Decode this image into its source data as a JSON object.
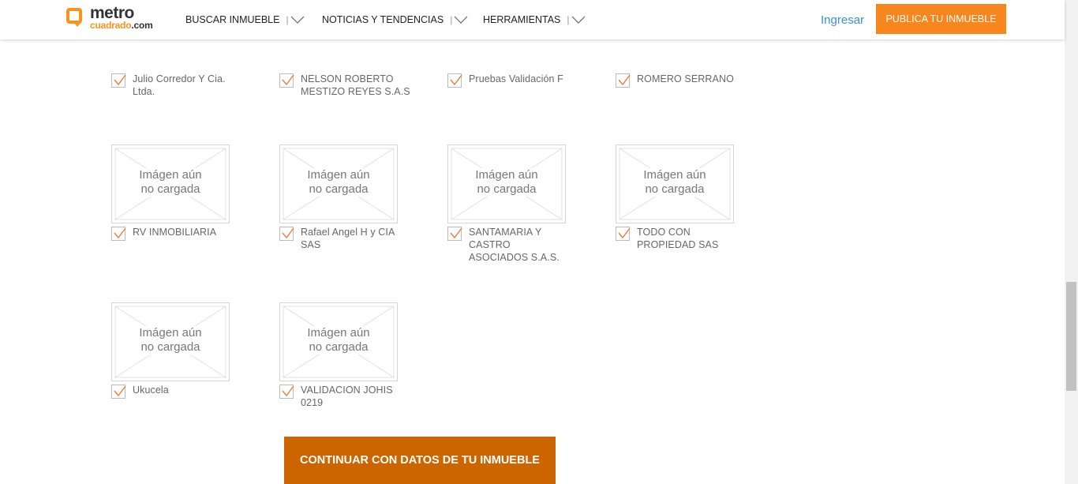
{
  "header": {
    "logo_top": "metro",
    "logo_bottom": "cuadrado",
    "logo_suffix": ".com",
    "nav": [
      {
        "label": "BUSCAR INMUEBLE"
      },
      {
        "label": "NOTICIAS Y TENDENCIAS"
      },
      {
        "label": "HERRAMIENTAS"
      }
    ],
    "login_label": "Ingresar",
    "publish_label": "PUBLICA TU INMUEBLE"
  },
  "placeholder": {
    "line1": "Imágen aún",
    "line2": "no cargada"
  },
  "top_row_logo_text": "cuadrado",
  "agencies": [
    {
      "name": "Julio Corredor Y Cia. Ltda.",
      "checked": true
    },
    {
      "name": "NELSON ROBERTO MESTIZO REYES S.A.S",
      "checked": true
    },
    {
      "name": "Pruebas Validación F",
      "checked": true
    },
    {
      "name": "ROMERO SERRANO",
      "checked": true
    },
    {
      "name": "RV INMOBILIARIA",
      "checked": true
    },
    {
      "name": "Rafael Angel H y CIA SAS",
      "checked": true
    },
    {
      "name": "SANTAMARIA Y CASTRO ASOCIADOS S.A.S.",
      "checked": true
    },
    {
      "name": "TODO CON PROPIEDAD SAS",
      "checked": true
    },
    {
      "name": "Ukucela",
      "checked": true
    },
    {
      "name": "VALIDACION JOHIS 0219",
      "checked": true
    }
  ],
  "continue_label": "CONTINUAR CON DATOS DE TU INMUEBLE",
  "colors": {
    "brand_orange": "#f7861d",
    "continue_bg": "#cc6500",
    "login_blue": "#3a8ed6",
    "check_orange": "#f07a3c"
  }
}
